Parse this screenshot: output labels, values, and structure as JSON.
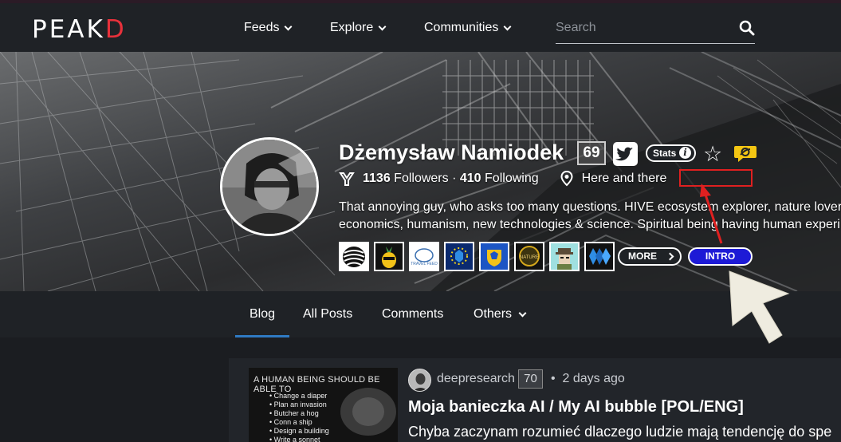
{
  "app": {
    "logo_left": "PE",
    "logo_mid": "A",
    "logo_k": "K",
    "logo_d": "D"
  },
  "nav": {
    "items": [
      {
        "label": "Feeds"
      },
      {
        "label": "Explore"
      },
      {
        "label": "Communities"
      }
    ],
    "search_placeholder": "Search"
  },
  "profile": {
    "name": "Dżemysław Namiodek",
    "reputation": "69",
    "stats_label": "Stats",
    "followers_count": "1136",
    "followers_label": "Followers",
    "separator": "·",
    "following_count": "410",
    "following_label": "Following",
    "location": "Here and there",
    "bio_line1": "That annoying guy, who asks too many questions. HIVE ecosystem explorer, nature lover,",
    "bio_line2": "economics, humanism, new technologies & science. Spiritual being having human experi",
    "more_label": "MORE",
    "intro_label": "INTRO",
    "badges": [
      "hive-badge-1",
      "pineapple-badge",
      "travel-feed-badge",
      "eu-badge",
      "coat-of-arms-badge",
      "hive-nature-badge",
      "detective-badge",
      "hive-blue-badge"
    ]
  },
  "tabs": [
    {
      "label": "Blog"
    },
    {
      "label": "All Posts"
    },
    {
      "label": "Comments"
    },
    {
      "label": "Others"
    }
  ],
  "post": {
    "author": "deepresearch",
    "author_rep": "70",
    "dot": "•",
    "time": "2 days ago",
    "title": "Moja banieczka AI / My AI bubble [POL/ENG]",
    "excerpt": "Chyba zaczynam rozumieć dlaczego ludzie mają tendencję do spe",
    "thumb_heading": "A HUMAN BEING SHOULD BE ABLE TO",
    "thumb_items": [
      "Change a diaper",
      "Plan an invasion",
      "Butcher a hog",
      "Conn a ship",
      "Design a building",
      "Write a sonnet"
    ]
  },
  "colors": {
    "accent_red": "#e8313b",
    "intro_blue": "#1d1ad6",
    "tab_underline": "#2f7ac3",
    "annotation_red": "#e02020"
  }
}
